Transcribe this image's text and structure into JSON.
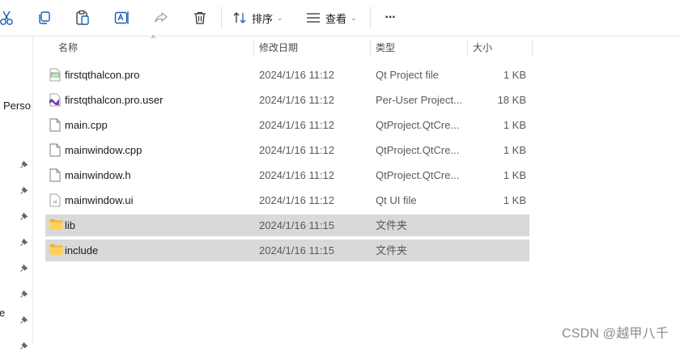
{
  "toolbar": {
    "sort_label": "排序",
    "view_label": "查看",
    "more_label": "···"
  },
  "nav": {
    "partial_label_1": "Perso",
    "partial_label_2": "e"
  },
  "columns": {
    "name": "名称",
    "date": "修改日期",
    "type": "类型",
    "size": "大小"
  },
  "files": [
    {
      "name": "firstqthalcon.pro",
      "date": "2024/1/16 11:12",
      "type": "Qt Project file",
      "size": "1 KB",
      "icon": "qt-pro-icon"
    },
    {
      "name": "firstqthalcon.pro.user",
      "date": "2024/1/16 11:12",
      "type": "Per-User Project...",
      "size": "18 KB",
      "icon": "visual-studio-icon"
    },
    {
      "name": "main.cpp",
      "date": "2024/1/16 11:12",
      "type": "QtProject.QtCre...",
      "size": "1 KB",
      "icon": "document-icon"
    },
    {
      "name": "mainwindow.cpp",
      "date": "2024/1/16 11:12",
      "type": "QtProject.QtCre...",
      "size": "1 KB",
      "icon": "document-icon"
    },
    {
      "name": "mainwindow.h",
      "date": "2024/1/16 11:12",
      "type": "QtProject.QtCre...",
      "size": "1 KB",
      "icon": "document-icon"
    },
    {
      "name": "mainwindow.ui",
      "date": "2024/1/16 11:12",
      "type": "Qt UI file",
      "size": "1 KB",
      "icon": "ui-file-icon"
    },
    {
      "name": "lib",
      "date": "2024/1/16 11:15",
      "type": "文件夹",
      "size": "",
      "icon": "folder-icon",
      "selected": true
    },
    {
      "name": "include",
      "date": "2024/1/16 11:15",
      "type": "文件夹",
      "size": "",
      "icon": "folder-icon",
      "selected": true
    }
  ],
  "watermark": "CSDN @越甲八千",
  "colors": {
    "selection": "#d9d9d9",
    "folder": "#f5c342",
    "toolbar_icon": "#1a5fb4"
  }
}
